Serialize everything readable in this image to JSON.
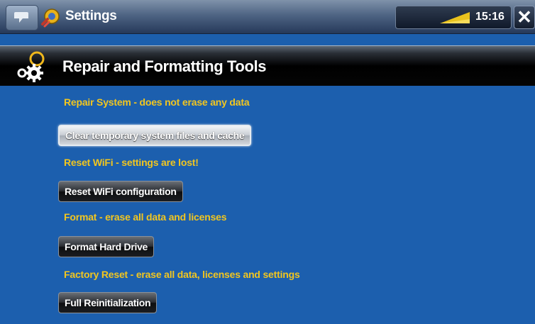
{
  "topbar": {
    "app_title": "Settings",
    "clock": "15:16",
    "icons": {
      "home": "menu-home-icon",
      "app": "settings-icon",
      "signal": "signal-strength-icon",
      "close": "close-icon"
    },
    "close_glyph": "✕"
  },
  "section": {
    "title": "Repair and Formatting Tools",
    "icon": "gears-icon"
  },
  "items": [
    {
      "note": "Repair System - does not erase any data",
      "button": "Clear temporary system files and cache",
      "selected": true
    },
    {
      "note": "Reset WiFi - settings are lost!",
      "button": "Reset WiFi configuration",
      "selected": false
    },
    {
      "note": "Format - erase all data and licenses",
      "button": "Format Hard Drive",
      "selected": false
    },
    {
      "note": "Factory Reset - erase all data, licenses and settings",
      "button": "Full Reinitialization",
      "selected": false
    }
  ],
  "colors": {
    "background": "#1c5fae",
    "note_text": "#f2c61f",
    "header_bg": "#000000"
  }
}
